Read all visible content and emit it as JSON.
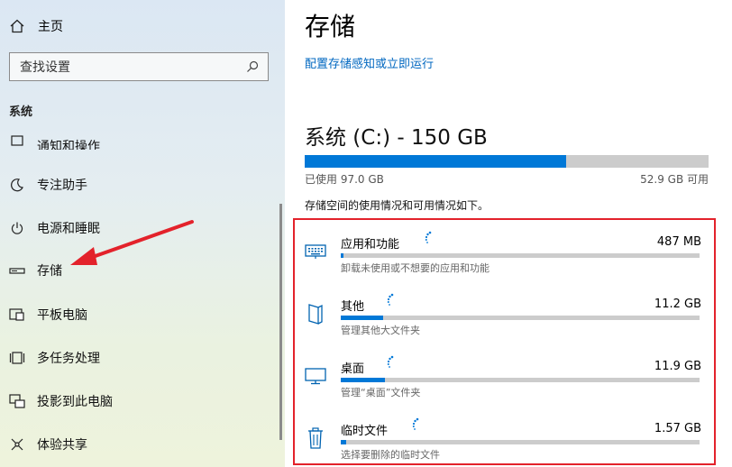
{
  "sidebar": {
    "home_label": "主页",
    "search_placeholder": "查找设置",
    "section_label": "系统",
    "clipped_item_label": "通知和操作",
    "items": [
      {
        "label": "专注助手",
        "icon": "moon-icon"
      },
      {
        "label": "电源和睡眠",
        "icon": "power-icon"
      },
      {
        "label": "存储",
        "icon": "storage-icon"
      },
      {
        "label": "平板电脑",
        "icon": "tablet-icon"
      },
      {
        "label": "多任务处理",
        "icon": "multitask-icon"
      },
      {
        "label": "投影到此电脑",
        "icon": "project-icon"
      },
      {
        "label": "体验共享",
        "icon": "share-icon"
      }
    ],
    "annotation_arrow_color": "#e3222b"
  },
  "main": {
    "title": "存储",
    "config_link": "配置存储感知或立即运行",
    "drive": {
      "title": "系统 (C:) - 150 GB",
      "used_label": "已使用 97.0 GB",
      "available_label": "52.9 GB 可用",
      "used_fraction": 0.647
    },
    "description": "存储空间的使用情况和可用情况如下。",
    "categories": [
      {
        "name": "应用和功能",
        "size": "487 MB",
        "sub": "卸载未使用或不想要的应用和功能",
        "fraction": 0.004,
        "icon": "keyboard-icon"
      },
      {
        "name": "其他",
        "size": "11.2 GB",
        "sub": "管理其他大文件夹",
        "fraction": 0.117,
        "icon": "folder-icon"
      },
      {
        "name": "桌面",
        "size": "11.9 GB",
        "sub": "管理“桌面”文件夹",
        "fraction": 0.124,
        "icon": "desktop-icon"
      },
      {
        "name": "临时文件",
        "size": "1.57 GB",
        "sub": "选择要删除的临时文件",
        "fraction": 0.016,
        "icon": "trash-icon"
      }
    ],
    "highlight_color": "#e3222b",
    "accent_color": "#0078d7",
    "link_color": "#0067c0"
  }
}
